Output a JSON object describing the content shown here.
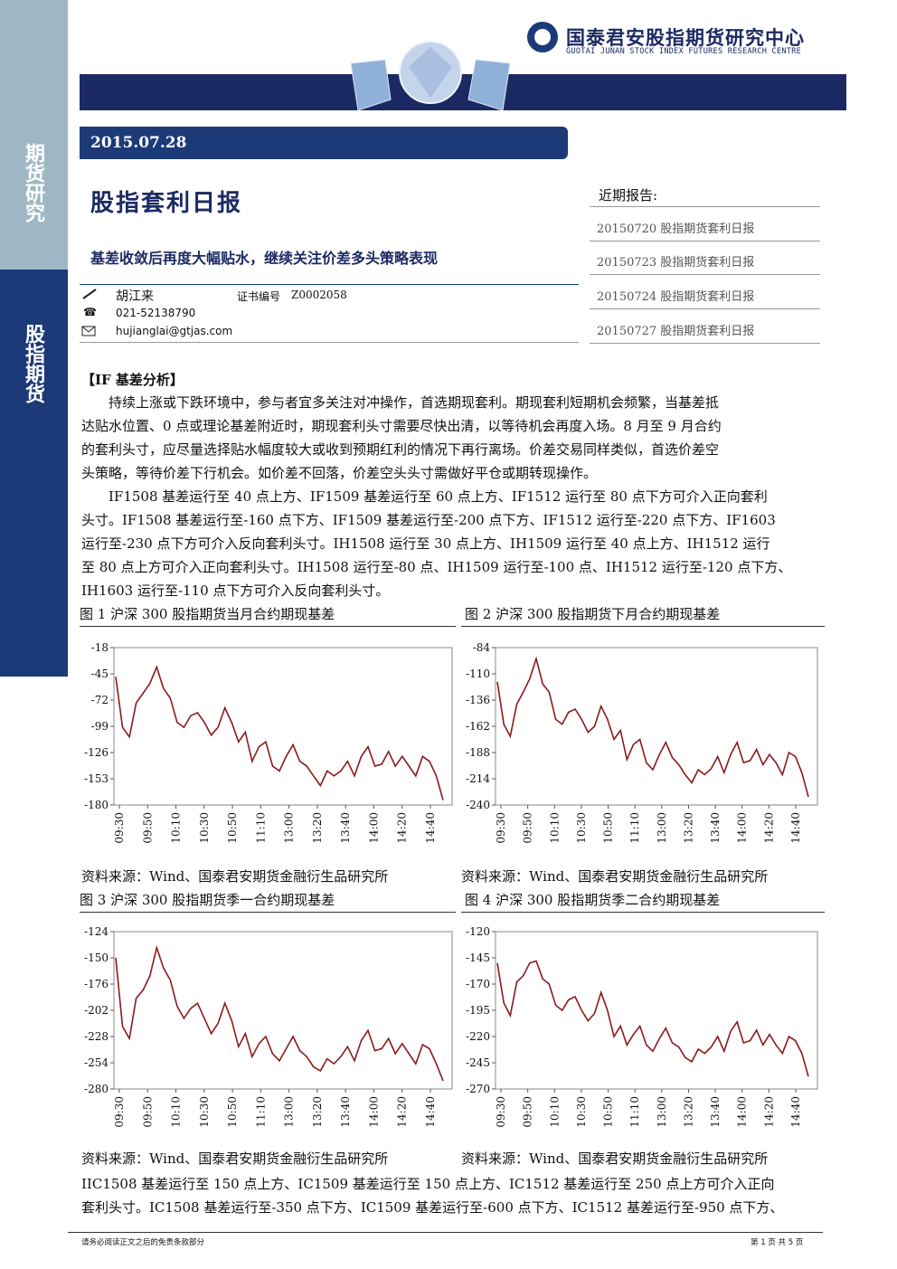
{
  "sidebar": {
    "top_label": "期货研究",
    "mid_label": "股指期货"
  },
  "header": {
    "org_name": "国泰君安股指期货研究中心",
    "org_name_en": "GUOTAI JUNAN STOCK INDEX FUTURES RESEARCH CENTRE",
    "date": "2015.07.28",
    "title": "股指套利日报",
    "subtitle": "基差收敛后再度大幅贴水，继续关注价差多头策略表现"
  },
  "author": {
    "name": "胡江来",
    "cert_label": "证书编号",
    "cert_no": "Z0002058",
    "phone": "021-52138790",
    "email": "hujianglai@gtjas.com"
  },
  "recent": {
    "heading": "近期报告:",
    "items": [
      "20150720 股指期货套利日报",
      "20150723 股指期货套利日报",
      "20150724 股指期货套利日报",
      "20150727 股指期货套利日报"
    ]
  },
  "body": {
    "section": "【IF 基差分析】",
    "p1": [
      "持续上涨或下跌环境中，参与者宜多关注对冲操作，首选期现套利。期现套利短期机会频繁，当基差抵",
      "达贴水位置、0 点或理论基差附近时，期现套利头寸需要尽快出清，以等待机会再度入场。8 月至 9 月合约",
      "的套利头寸，应尽量选择贴水幅度较大或收到预期红利的情况下再行离场。价差交易同样类似，首选价差空",
      "头策略，等待价差下行机会。如价差不回落，价差空头头寸需做好平仓或期转现操作。"
    ],
    "p2": [
      "IF1508 基差运行至 40 点上方、IF1509 基差运行至 60 点上方、IF1512 运行至 80 点下方可介入正向套利",
      "头寸。IF1508 基差运行至-160 点下方、IF1509 基差运行至-200 点下方、IF1512 运行至-220 点下方、IF1603",
      "运行至-230 点下方可介入反向套利头寸。IH1508 运行至 30 点上方、IH1509 运行至 40 点上方、IH1512 运行",
      "至 80 点上方可介入正向套利头寸。IH1508 运行至-80 点、IH1509 运行至-100 点、IH1512 运行至-120 点下方、",
      "IH1603 运行至-110 点下方可介入反向套利头寸。"
    ],
    "p3": [
      "IIC1508 基差运行至 150 点上方、IC1509 基差运行至 150 点上方、IC1512 基差运行至 250 点上方可介入正向",
      "套利头寸。IC1508 基差运行至-350 点下方、IC1509 基差运行至-600 点下方、IC1512 基差运行至-950 点下方、"
    ]
  },
  "figures": {
    "titles": [
      "图 1 沪深 300 股指期货当月合约期现基差",
      "图 2 沪深 300 股指期货下月合约期现基差",
      "图 3 沪深 300 股指期货季一合约期现基差",
      "图 4 沪深 300 股指期货季二合约期现基差"
    ],
    "source": "资料来源：Wind、国泰君安期货金融衍生品研究所"
  },
  "chart_data": [
    {
      "type": "line",
      "x": [
        "09:30",
        "09:50",
        "10:10",
        "10:30",
        "10:50",
        "11:10",
        "13:00",
        "13:20",
        "13:40",
        "14:00",
        "14:20",
        "14:40"
      ],
      "yticks": [
        -18,
        -45,
        -72,
        -99,
        -126,
        -153,
        -180
      ],
      "ylim": [
        -180,
        -18
      ],
      "series": [
        {
          "values": [
            -48,
            -100,
            -110,
            -75,
            -65,
            -55,
            -38,
            -60,
            -70,
            -95,
            -100,
            -88,
            -85,
            -95,
            -108,
            -100,
            -80,
            -95,
            -115,
            -105,
            -135,
            -120,
            -115,
            -140,
            -145,
            -130,
            -118,
            -135,
            -140,
            -150,
            -160,
            -145,
            -150,
            -145,
            -135,
            -150,
            -130,
            -120,
            -140,
            -138,
            -125,
            -140,
            -130,
            -140,
            -150,
            -130,
            -135,
            -150,
            -175
          ],
          "color": "#8b1a1a"
        }
      ]
    },
    {
      "type": "line",
      "x": [
        "09:30",
        "09:50",
        "10:10",
        "10:30",
        "10:50",
        "11:10",
        "13:00",
        "13:20",
        "13:40",
        "14:00",
        "14:20",
        "14:40"
      ],
      "yticks": [
        -84,
        -110,
        -136,
        -162,
        -188,
        -214,
        -240
      ],
      "ylim": [
        -240,
        -84
      ],
      "series": [
        {
          "values": [
            -118,
            -160,
            -172,
            -140,
            -128,
            -115,
            -95,
            -120,
            -128,
            -155,
            -160,
            -148,
            -145,
            -155,
            -168,
            -162,
            -142,
            -155,
            -175,
            -166,
            -195,
            -180,
            -175,
            -198,
            -205,
            -190,
            -178,
            -193,
            -200,
            -210,
            -218,
            -205,
            -210,
            -204,
            -192,
            -208,
            -190,
            -178,
            -198,
            -196,
            -185,
            -200,
            -190,
            -198,
            -210,
            -188,
            -192,
            -208,
            -232
          ],
          "color": "#8b1a1a"
        }
      ]
    },
    {
      "type": "line",
      "x": [
        "09:30",
        "09:50",
        "10:10",
        "10:30",
        "10:50",
        "11:10",
        "13:00",
        "13:20",
        "13:40",
        "14:00",
        "14:20",
        "14:40"
      ],
      "yticks": [
        -124,
        -150,
        -176,
        -202,
        -228,
        -254,
        -280
      ],
      "ylim": [
        -280,
        -124
      ],
      "series": [
        {
          "values": [
            -150,
            -218,
            -230,
            -190,
            -182,
            -168,
            -140,
            -160,
            -172,
            -198,
            -210,
            -200,
            -195,
            -210,
            -225,
            -215,
            -195,
            -212,
            -238,
            -225,
            -248,
            -235,
            -228,
            -245,
            -252,
            -240,
            -228,
            -242,
            -248,
            -258,
            -262,
            -250,
            -255,
            -248,
            -238,
            -252,
            -232,
            -222,
            -242,
            -240,
            -230,
            -245,
            -235,
            -245,
            -255,
            -236,
            -240,
            -255,
            -272
          ],
          "color": "#8b1a1a"
        }
      ]
    },
    {
      "type": "line",
      "x": [
        "09:30",
        "09:50",
        "10:10",
        "10:30",
        "10:50",
        "11:10",
        "13:00",
        "13:20",
        "13:40",
        "14:00",
        "14:20",
        "14:40"
      ],
      "yticks": [
        -120,
        -145,
        -170,
        -195,
        -220,
        -245,
        -270
      ],
      "ylim": [
        -270,
        -120
      ],
      "series": [
        {
          "values": [
            -150,
            -188,
            -200,
            -168,
            -162,
            -150,
            -148,
            -165,
            -170,
            -190,
            -195,
            -185,
            -182,
            -195,
            -205,
            -198,
            -178,
            -195,
            -220,
            -210,
            -228,
            -218,
            -210,
            -228,
            -234,
            -222,
            -212,
            -226,
            -230,
            -240,
            -244,
            -232,
            -236,
            -230,
            -220,
            -234,
            -215,
            -206,
            -226,
            -224,
            -214,
            -228,
            -218,
            -228,
            -236,
            -220,
            -224,
            -236,
            -258
          ],
          "color": "#8b1a1a"
        }
      ]
    }
  ],
  "footer": {
    "disclaimer": "请务必阅读正文之后的免责条款部分",
    "page": "第 1 页 共 5 页"
  }
}
